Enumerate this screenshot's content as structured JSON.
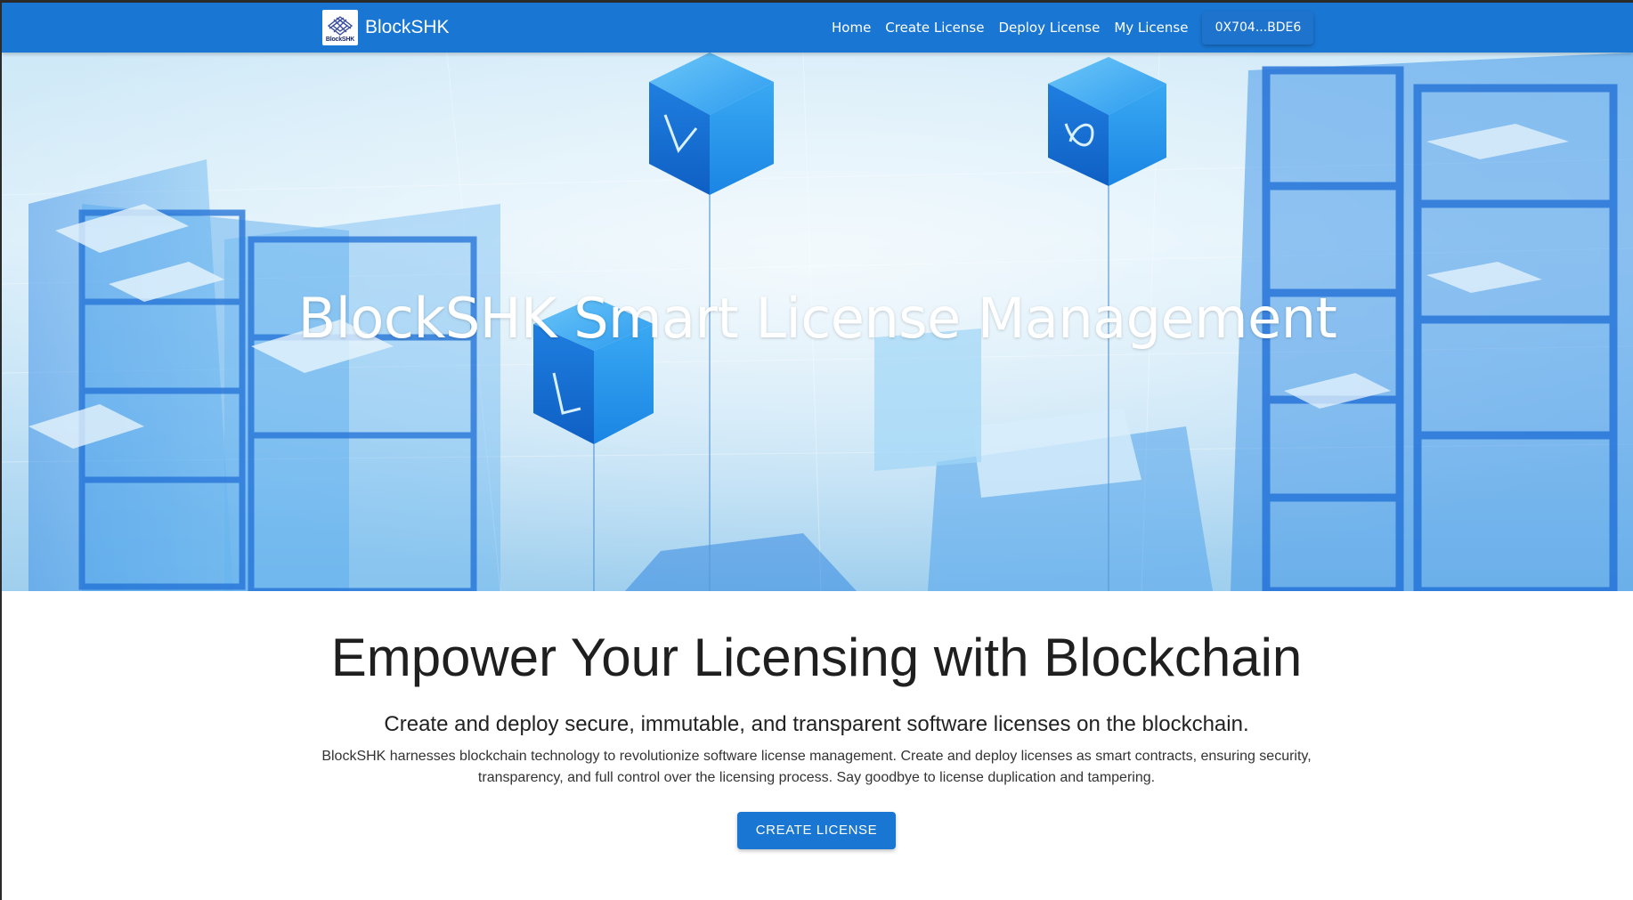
{
  "navbar": {
    "brand_name": "BlockSHK",
    "logo_text": "BlockSHK",
    "links": [
      "Home",
      "Create License",
      "Deploy License",
      "My License"
    ],
    "wallet_address": "0X704...BDE6",
    "color": "#1976d2"
  },
  "hero": {
    "title": "BlockSHK Smart License Management"
  },
  "main": {
    "headline": "Empower Your Licensing with Blockchain",
    "subheadline": "Create and deploy secure, immutable, and transparent software licenses on the blockchain.",
    "description": "BlockSHK harnesses blockchain technology to revolutionize software license management. Create and deploy licenses as smart contracts, ensuring security, transparency, and full control over the licensing process. Say goodbye to license duplication and tampering.",
    "cta_label": "CREATE LICENSE"
  }
}
